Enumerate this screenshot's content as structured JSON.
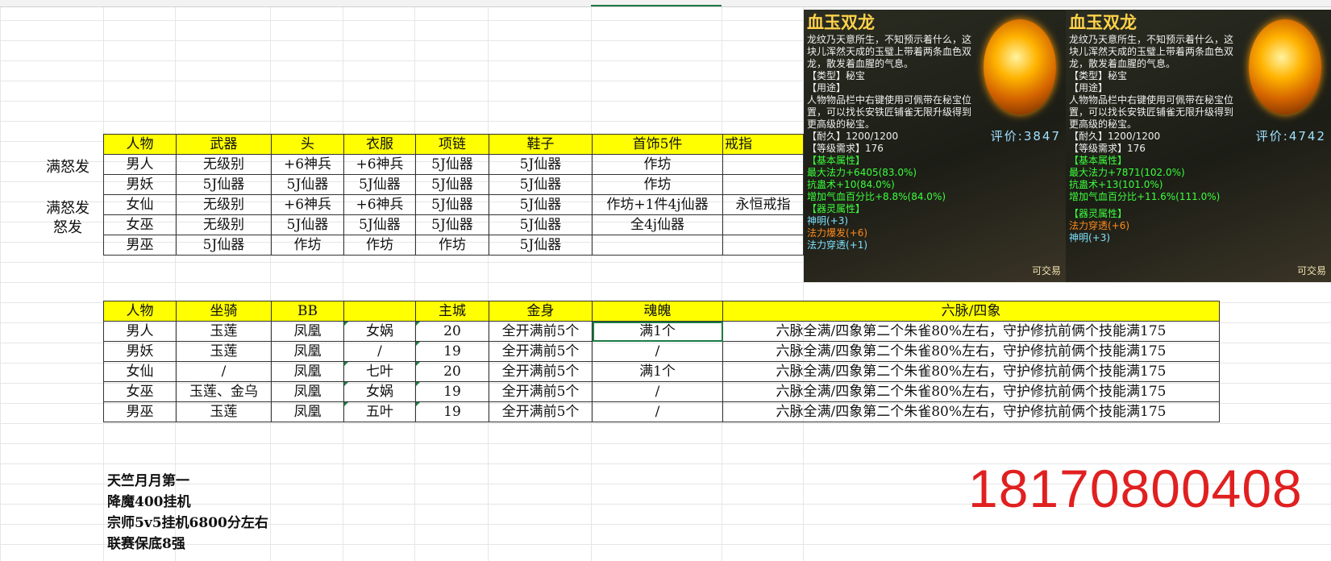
{
  "table1": {
    "headers": [
      "人物",
      "武器",
      "头",
      "衣服",
      "项链",
      "鞋子",
      "首饰5件",
      "戒指"
    ],
    "rows": [
      [
        "男人",
        "无级别",
        "+6神兵",
        "+6神兵",
        "5J仙器",
        "5J仙器",
        "作坊",
        ""
      ],
      [
        "男妖",
        "5J仙器",
        "5J仙器",
        "5J仙器",
        "5J仙器",
        "5J仙器",
        "作坊",
        ""
      ],
      [
        "女仙",
        "无级别",
        "+6神兵",
        "+6神兵",
        "5J仙器",
        "5J仙器",
        "作坊+1件4j仙器",
        "永恒戒指"
      ],
      [
        "女巫",
        "无级别",
        "5J仙器",
        "5J仙器",
        "5J仙器",
        "5J仙器",
        "全4j仙器",
        ""
      ],
      [
        "男巫",
        "5J仙器",
        "作坊",
        "作坊",
        "作坊",
        "5J仙器",
        "",
        ""
      ]
    ]
  },
  "side_labels": {
    "a": "满怒发",
    "b": "满怒发",
    "c": "怒发"
  },
  "table2": {
    "headers": [
      "人物",
      "坐骑",
      "BB",
      "",
      "主城",
      "金身",
      "魂魄",
      "六脉/四象"
    ],
    "rows": [
      [
        "男人",
        "玉莲",
        "凤凰",
        "女娲",
        "20",
        "全开满前5个",
        "满1个",
        "六脉全满/四象第二个朱雀80%左右，守护修抗前俩个技能满175"
      ],
      [
        "男妖",
        "玉莲",
        "凤凰",
        "/",
        "19",
        "全开满前5个",
        "/",
        "六脉全满/四象第二个朱雀80%左右，守护修抗前俩个技能满175"
      ],
      [
        "女仙",
        "/",
        "凤凰",
        "七叶",
        "20",
        "全开满前5个",
        "满1个",
        "六脉全满/四象第二个朱雀80%左右，守护修抗前俩个技能满175"
      ],
      [
        "女巫",
        "玉莲、金乌",
        "凤凰",
        "女娲",
        "19",
        "全开满前5个",
        "/",
        "六脉全满/四象第二个朱雀80%左右，守护修抗前俩个技能满175"
      ],
      [
        "男巫",
        "玉莲",
        "凤凰",
        "五叶",
        "19",
        "全开满前5个",
        "/",
        "六脉全满/四象第二个朱雀80%左右，守护修抗前俩个技能满175"
      ]
    ]
  },
  "notes": [
    "天竺月月第一",
    "降魔400挂机",
    "宗师5v5挂机6800分左右",
    "联赛保底8强"
  ],
  "phone": "18170800408",
  "game1": {
    "title": "血玉双龙",
    "desc": "龙纹乃天意所生，不知预示着什么，这块儿浑然天成的玉璧上带着两条血色双龙，散发着血腥的气息。",
    "type": "【类型】秘宝",
    "use_head": "【用途】",
    "use": "人物物品栏中右键使用可佩带在秘宝位置，可以找长安铁匠铺雀无限升级得到更高级的秘宝。",
    "durability": "【耐久】1200/1200",
    "level": "【等级需求】176",
    "basic_head": "【基本属性】",
    "stat1": "最大法力+6405(83.0%)",
    "stat2": "抗蛊术+10(84.0%)",
    "stat3": "增加气血百分比+8.8%(84.0%)",
    "spirit_head": "【器灵属性】",
    "spirit1": "神明(+3)",
    "spirit2": "法力爆发(+6)",
    "spirit3": "法力穿透(+1)",
    "score": "评价:3847",
    "trade": "可交易"
  },
  "game2": {
    "title": "血玉双龙",
    "desc": "龙纹乃天意所生，不知预示着什么，这块儿浑然天成的玉璧上带着两条血色双龙，散发着血腥的气息。",
    "type": "【类型】秘宝",
    "use_head": "【用途】",
    "use": "人物物品栏中右键使用可佩带在秘宝位置，可以找长安铁匠铺雀无限升级得到更高级的秘宝。",
    "durability": "【耐久】1200/1200",
    "level": "【等级需求】176",
    "basic_head": "【基本属性】",
    "stat1": "最大法力+7871(102.0%)",
    "stat2": "抗蛊术+13(101.0%)",
    "stat3": "增加气血百分比+11.6%(111.0%)",
    "spirit_head": "【器灵属性】",
    "spirit1": "法力穿透(+6)",
    "spirit2": "神明(+3)",
    "score": "评价:4742",
    "trade": "可交易"
  }
}
